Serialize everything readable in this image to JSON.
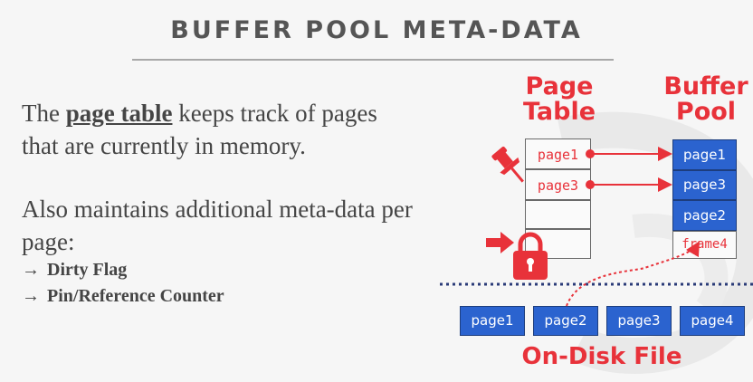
{
  "slide": {
    "title": "BUFFER POOL META-DATA",
    "intro": {
      "before": "The ",
      "term": "page table",
      "after": " keeps track of pages that are currently in memory."
    },
    "more": "Also maintains additional meta-data per page:",
    "bullets": [
      {
        "arrow": "→",
        "label": "Dirty Flag"
      },
      {
        "arrow": "→",
        "label": "Pin/Reference Counter"
      }
    ]
  },
  "diagram": {
    "page_table_heading": "Page Table",
    "buffer_pool_heading": "Buffer Pool",
    "disk_heading": "On-Disk File",
    "page_table_entries": [
      "page1",
      "page3",
      "",
      ""
    ],
    "buffer_pool_frames": [
      "page1",
      "page3",
      "page2",
      "frame4"
    ],
    "disk_pages": [
      "page1",
      "page2",
      "page3",
      "page4"
    ],
    "colors": {
      "accent": "#e8323a",
      "page_blue": "#2b63cf",
      "text": "#454545",
      "title": "#555555"
    },
    "icons": [
      "pushpin-icon",
      "padlock-icon",
      "pointer-arrow-icon"
    ]
  }
}
